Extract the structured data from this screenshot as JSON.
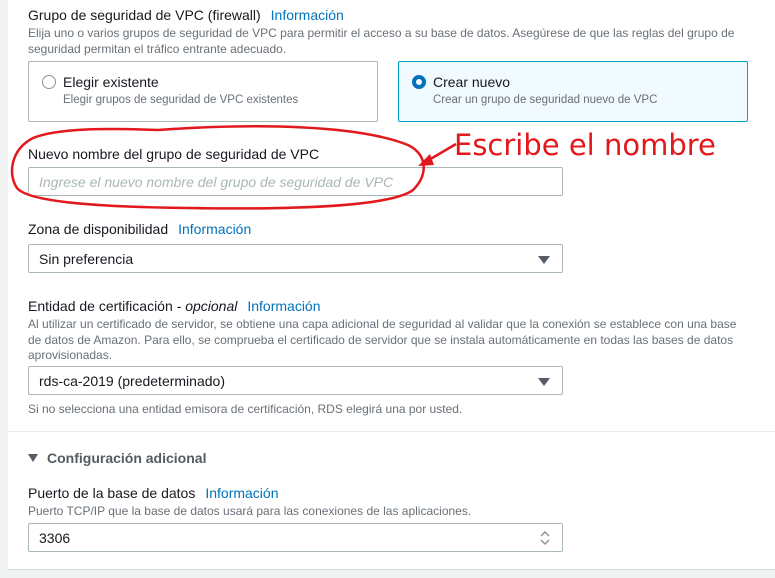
{
  "vpc": {
    "title": "Grupo de seguridad de VPC (firewall)",
    "info": "Información",
    "desc_line1": "Elija uno o varios grupos de seguridad de VPC para permitir el acceso a su base de datos. Asegúrese de que las reglas del grupo de",
    "desc_line2": "seguridad permitan el tráfico entrante adecuado.",
    "options": [
      {
        "title": "Elegir existente",
        "desc": "Elegir grupos de seguridad de VPC existentes",
        "selected": false
      },
      {
        "title": "Crear nuevo",
        "desc": "Crear un grupo de seguridad nuevo de VPC",
        "selected": true
      }
    ]
  },
  "new_group": {
    "label": "Nuevo nombre del grupo de seguridad de VPC",
    "placeholder": "Ingrese el nuevo nombre del grupo de seguridad de VPC",
    "value": ""
  },
  "annotation": {
    "text": "Escribe el nombre",
    "color": "#e3181c"
  },
  "az": {
    "label": "Zona de disponibilidad",
    "info": "Información",
    "value": "Sin preferencia"
  },
  "ca": {
    "label": "Entidad de certificación",
    "optional": "- opcional",
    "info": "Información",
    "desc_line1": "Al utilizar un certificado de servidor, se obtiene una capa adicional de seguridad al validar que la conexión se establece con una base",
    "desc_line2": "de datos de Amazon. Para ello, se comprueba el certificado de servidor que se instala automáticamente en todas las bases de datos",
    "desc_line3": "aprovisionadas.",
    "value": "rds-ca-2019 (predeterminado)",
    "hint": "Si no selecciona una entidad emisora de certificación, RDS elegirá una por usted."
  },
  "additional": {
    "title": "Configuración adicional",
    "expanded": true
  },
  "port": {
    "label": "Puerto de la base de datos",
    "info": "Información",
    "desc": "Puerto TCP/IP que la base de datos usará para las conexiones de las aplicaciones.",
    "value": "3306"
  },
  "colors": {
    "link": "#0073bb",
    "selected_border": "#00a1c9",
    "selected_bg": "#f1faff",
    "annotation": "#e3181c"
  }
}
